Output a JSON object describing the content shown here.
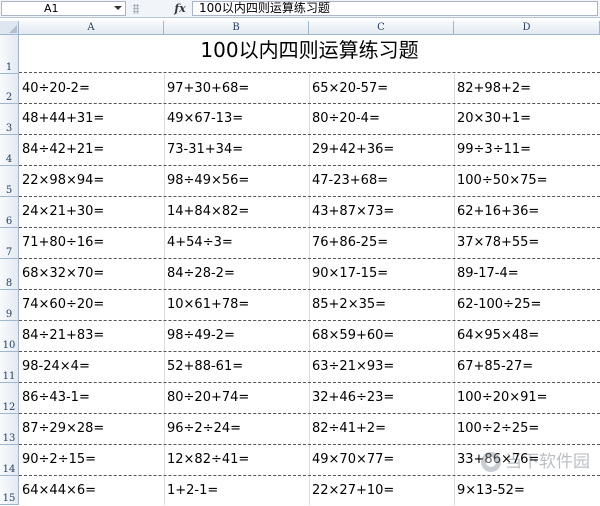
{
  "formula_bar": {
    "name_box": "A1",
    "fx_label": "fx",
    "content": "100以内四则运算练习题"
  },
  "sheet": {
    "columns": [
      "A",
      "B",
      "C",
      "D"
    ],
    "rows": [
      "1",
      "2",
      "3",
      "4",
      "5",
      "6",
      "7",
      "8",
      "9",
      "10",
      "11",
      "12",
      "13",
      "14",
      "15"
    ],
    "title": "100以内四则运算练习题",
    "cells": [
      [
        "40÷20-2=",
        "97+30+68=",
        "65×20-57=",
        "82+98+2="
      ],
      [
        "48+44+31=",
        "49×67-13=",
        "80÷20-4=",
        "20×30+1="
      ],
      [
        "84÷42+21=",
        "73-31+34=",
        "29+42+36=",
        "99÷3÷11="
      ],
      [
        "22×98×94=",
        "98÷49×56=",
        "47-23+68=",
        "100÷50×75="
      ],
      [
        "24×21+30=",
        "14+84×82=",
        "43+87×73=",
        "62+16+36="
      ],
      [
        "71+80÷16=",
        "4+54÷3=",
        "76+86-25=",
        "37×78+55="
      ],
      [
        "68×32×70=",
        "84÷28-2=",
        "90×17-15=",
        "89-17-4="
      ],
      [
        "74×60÷20=",
        "10×61+78=",
        "85+2×35=",
        "62-100÷25="
      ],
      [
        "84÷21+83=",
        "98÷49-2=",
        "68×59+60=",
        "64×95×48="
      ],
      [
        "98-24×4=",
        "52+88-61=",
        "63÷21×93=",
        "67+85-27="
      ],
      [
        "86÷43-1=",
        "80÷20+74=",
        "32+46÷23=",
        "100÷20×91="
      ],
      [
        "87÷29×28=",
        "96÷2÷24=",
        "82÷41+2=",
        "100÷2÷25="
      ],
      [
        "90÷2÷15=",
        "12×82÷41=",
        "49×70×77=",
        "33+86×76="
      ],
      [
        "64×44×6=",
        "1+2-1=",
        "22×27+10=",
        "9×13-52="
      ]
    ]
  },
  "watermark": {
    "text": "当下软件园"
  }
}
